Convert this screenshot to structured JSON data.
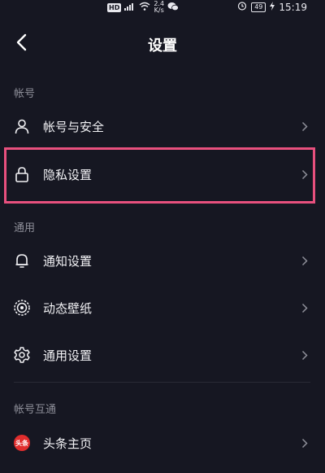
{
  "status_bar": {
    "hd": "HD",
    "net_speed_value": "2.4",
    "net_speed_unit": "K/s",
    "battery": "49",
    "time": "15:19"
  },
  "header": {
    "title": "设置"
  },
  "sections": {
    "account": {
      "label": "帐号",
      "items": [
        {
          "label": "帐号与安全",
          "icon": "user-icon"
        },
        {
          "label": "隐私设置",
          "icon": "lock-icon"
        }
      ]
    },
    "general": {
      "label": "通用",
      "items": [
        {
          "label": "通知设置",
          "icon": "bell-icon"
        },
        {
          "label": "动态壁纸",
          "icon": "wallpaper-icon"
        },
        {
          "label": "通用设置",
          "icon": "gear-icon"
        }
      ]
    },
    "linked": {
      "label": "帐号互通",
      "items": [
        {
          "label": "头条主页",
          "icon": "toutiao-logo",
          "logo_text": "头条"
        }
      ]
    }
  },
  "colors": {
    "background": "#161722",
    "highlight": "#e8507e",
    "text": "#f2f2f5",
    "muted": "#8e8f99"
  }
}
